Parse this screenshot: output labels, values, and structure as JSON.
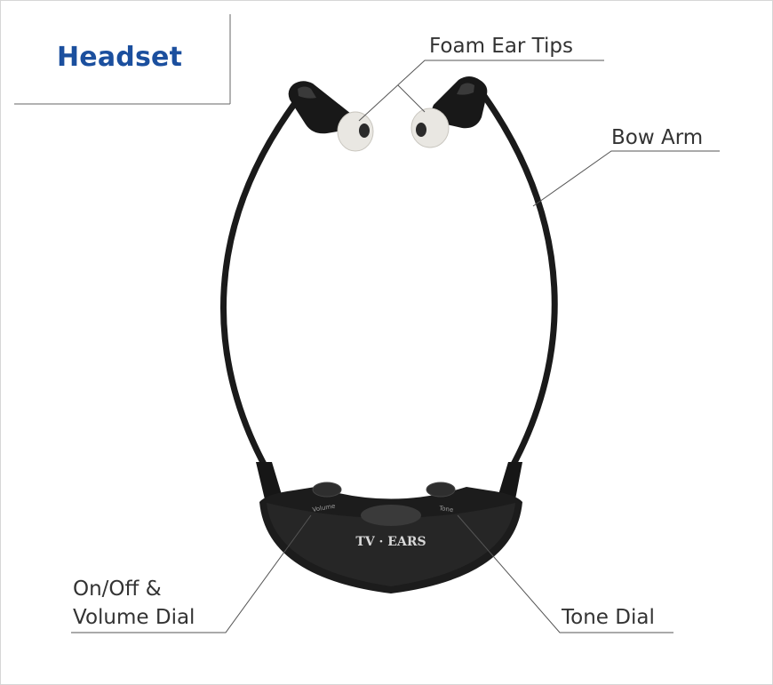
{
  "title": "Headset",
  "labels": {
    "foam_ear_tips": "Foam Ear Tips",
    "bow_arm": "Bow Arm",
    "on_off_line1": "On/Off &",
    "on_off_line2": "Volume Dial",
    "tone_dial": "Tone Dial"
  },
  "product_text": {
    "brand": "TV · EARS",
    "dial_left": "Volume",
    "dial_right": "Tone"
  },
  "colors": {
    "title": "#1b4f9e",
    "label": "#333333",
    "headset": "#141414",
    "ear_tip": "#e9e7e2",
    "leader_line": "#555555",
    "border": "#d6d6d6"
  }
}
